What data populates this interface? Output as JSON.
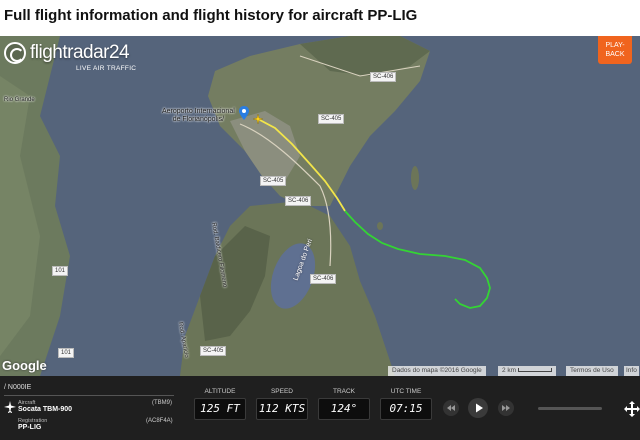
{
  "page": {
    "title": "Full flight information and flight history for aircraft PP-LIG"
  },
  "logo": {
    "name": "flightradar24",
    "tagline": "LIVE AIR TRAFFIC"
  },
  "playback": {
    "label_line1": "PLAY-",
    "label_line2": "BACK"
  },
  "map": {
    "airport_label_line1": "Aeroporto Internacional",
    "airport_label_line2": "de Florianópolis/",
    "roads": [
      "SC-406",
      "SC-405",
      "SC-405",
      "SC-406",
      "SC-406",
      "SC-405"
    ],
    "lake_label": "Lagoa do Peri",
    "road_name_1": "Rod. Baldicero Filomeno",
    "road_name_2": "Rod. Aparício",
    "left_place_1": "Rio Grande",
    "left_route": "101",
    "left_route_2": "101",
    "google": "Google",
    "attribution": "Dados do mapa ©2016 Google",
    "scale": "2 km",
    "terms": "Termos de Uso",
    "info": "Info",
    "track_colors": {
      "ground": "#f2e54a",
      "air": "#2ecc2e"
    }
  },
  "flight_panel": {
    "id": "/ N000IE",
    "aircraft_label": "Aircraft",
    "aircraft_value": "Socata TBM-900",
    "aircraft_code": "(TBM9)",
    "registration_label": "Registration",
    "registration_value": "PP-LIG",
    "registration_code": "(AC8F4A)",
    "altitude_label": "ALTITUDE",
    "altitude_value": "125 FT",
    "speed_label": "SPEED",
    "speed_value": "112 KTS",
    "track_label": "TRACK",
    "track_value": "124°",
    "utc_label": "UTC TIME",
    "utc_value": "07:15"
  },
  "icons": [
    "fr24-logo-icon",
    "airport-marker-icon",
    "aircraft-icon",
    "plane-icon",
    "rewind-icon",
    "play-icon",
    "fast-forward-icon",
    "move-icon"
  ]
}
